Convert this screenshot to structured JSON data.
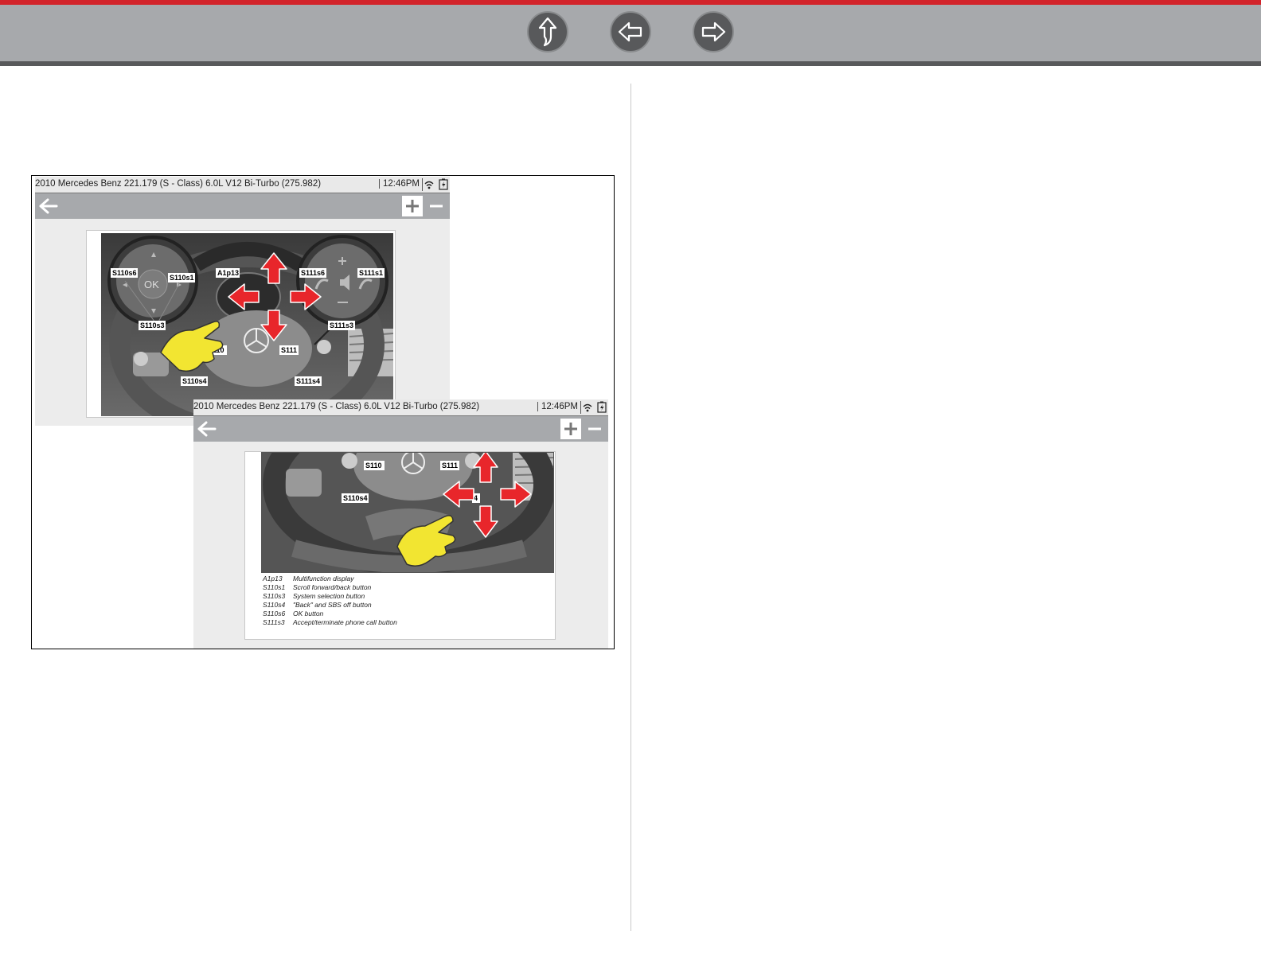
{
  "colors": {
    "accent_red": "#d2232a",
    "bar_grey": "#a7a9ac",
    "bar_dark": "#58595b",
    "arrow_red": "#e8262b",
    "hand_yellow": "#f2e531"
  },
  "nav": {
    "buttons": [
      {
        "name": "up-button",
        "icon": "up-arrow-icon"
      },
      {
        "name": "back-button",
        "icon": "left-arrow-icon"
      },
      {
        "name": "forward-button",
        "icon": "right-arrow-icon"
      }
    ]
  },
  "screen1": {
    "title": "2010 Mercedes Benz 221.179 (S - Class) 6.0L V12 Bi-Turbo (275.982)",
    "time": "12:46PM",
    "photo_labels": {
      "s110s6": "S110s6",
      "s110s1": "S110s1",
      "ok": "OK",
      "s110s3": "S110s3",
      "a1p13": "A1p13",
      "s111s6": "S111s6",
      "s111s1": "S111s1",
      "s111s3": "S111s3",
      "s110": "S110",
      "s111": "S111",
      "s110s4": "S110s4",
      "s111s4": "S111s4"
    }
  },
  "screen2": {
    "title": "2010 Mercedes Benz 221.179 (S - Class) 6.0L V12 Bi-Turbo (275.982)",
    "time": "12:46PM",
    "photo_labels": {
      "s110": "S110",
      "s111": "S111",
      "s110s4": "S110s4",
      "four": "4"
    },
    "legend": [
      {
        "code": "A1p13",
        "desc": "Multifunction display"
      },
      {
        "code": "S110s1",
        "desc": "Scroll forward/back button"
      },
      {
        "code": "S110s3",
        "desc": "System selection button"
      },
      {
        "code": "S110s4",
        "desc": "\"Back\" and SBS off button"
      },
      {
        "code": "S110s6",
        "desc": "OK button"
      },
      {
        "code": "S111s3",
        "desc": "Accept/terminate phone call button"
      }
    ]
  }
}
